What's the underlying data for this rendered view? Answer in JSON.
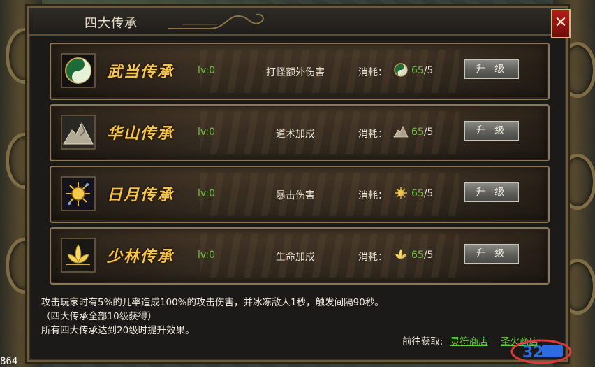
{
  "window": {
    "title": "四大传承",
    "close_glyph": "✕"
  },
  "rows": [
    {
      "name": "武当传承",
      "level": "lv:0",
      "effect": "打怪额外伤害",
      "cost_label": "消耗：",
      "cost_have": "65",
      "cost_need": "/5",
      "button": "升 级",
      "icon": "taiji-icon"
    },
    {
      "name": "华山传承",
      "level": "lv:0",
      "effect": "道术加成",
      "cost_label": "消耗：",
      "cost_have": "65",
      "cost_need": "/5",
      "button": "升 级",
      "icon": "mountain-icon"
    },
    {
      "name": "日月传承",
      "level": "lv:0",
      "effect": "暴击伤害",
      "cost_label": "消耗：",
      "cost_have": "65",
      "cost_need": "/5",
      "button": "升 级",
      "icon": "sun-moon-icon"
    },
    {
      "name": "少林传承",
      "level": "lv:0",
      "effect": "生命加成",
      "cost_label": "消耗：",
      "cost_have": "65",
      "cost_need": "/5",
      "button": "升 级",
      "icon": "lotus-icon"
    }
  ],
  "description": {
    "line1": "攻击玩家时有5%的几率造成100%的攻击伤害，并冰冻敌人1秒，触发间隔90秒。",
    "line2": "（四大传承全部10级获得）",
    "line3": "所有四大传承达到20级时提升效果。"
  },
  "goto": {
    "label": "前往获取:",
    "link1": "灵符商店",
    "link2": "圣火商店"
  },
  "corner_text": "864",
  "watermark_text": "32"
}
